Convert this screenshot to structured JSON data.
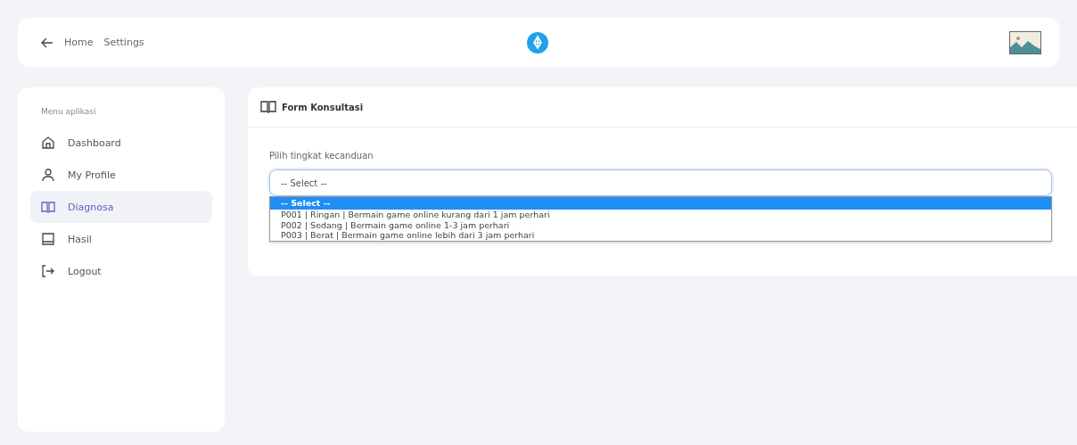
{
  "top_bar": {
    "links": [
      "Home",
      "Settings"
    ]
  },
  "sidebar": {
    "heading": "Menu aplikasi",
    "items": [
      {
        "label": "Dashboard",
        "selected": false
      },
      {
        "label": "My Profile",
        "selected": false
      },
      {
        "label": "Diagnosa",
        "selected": true
      },
      {
        "label": "Hasil",
        "selected": false
      },
      {
        "label": "Logout",
        "selected": false
      }
    ]
  },
  "card": {
    "title": "Form Konsultasi",
    "field_label": "Pilih tingkat kecanduan",
    "select_value": "-- Select --",
    "options": [
      {
        "label": "-- Select --",
        "selected": true
      },
      {
        "label": "P001 | Ringan | Bermain game online kurang dari 1 jam perhari",
        "selected": false
      },
      {
        "label": "P002 | Sedang | Bermain game online 1-3 jam perhari",
        "selected": false
      },
      {
        "label": "P003 | Berat | Bermain game online lebih dari 3 jam perhari",
        "selected": false
      }
    ]
  }
}
